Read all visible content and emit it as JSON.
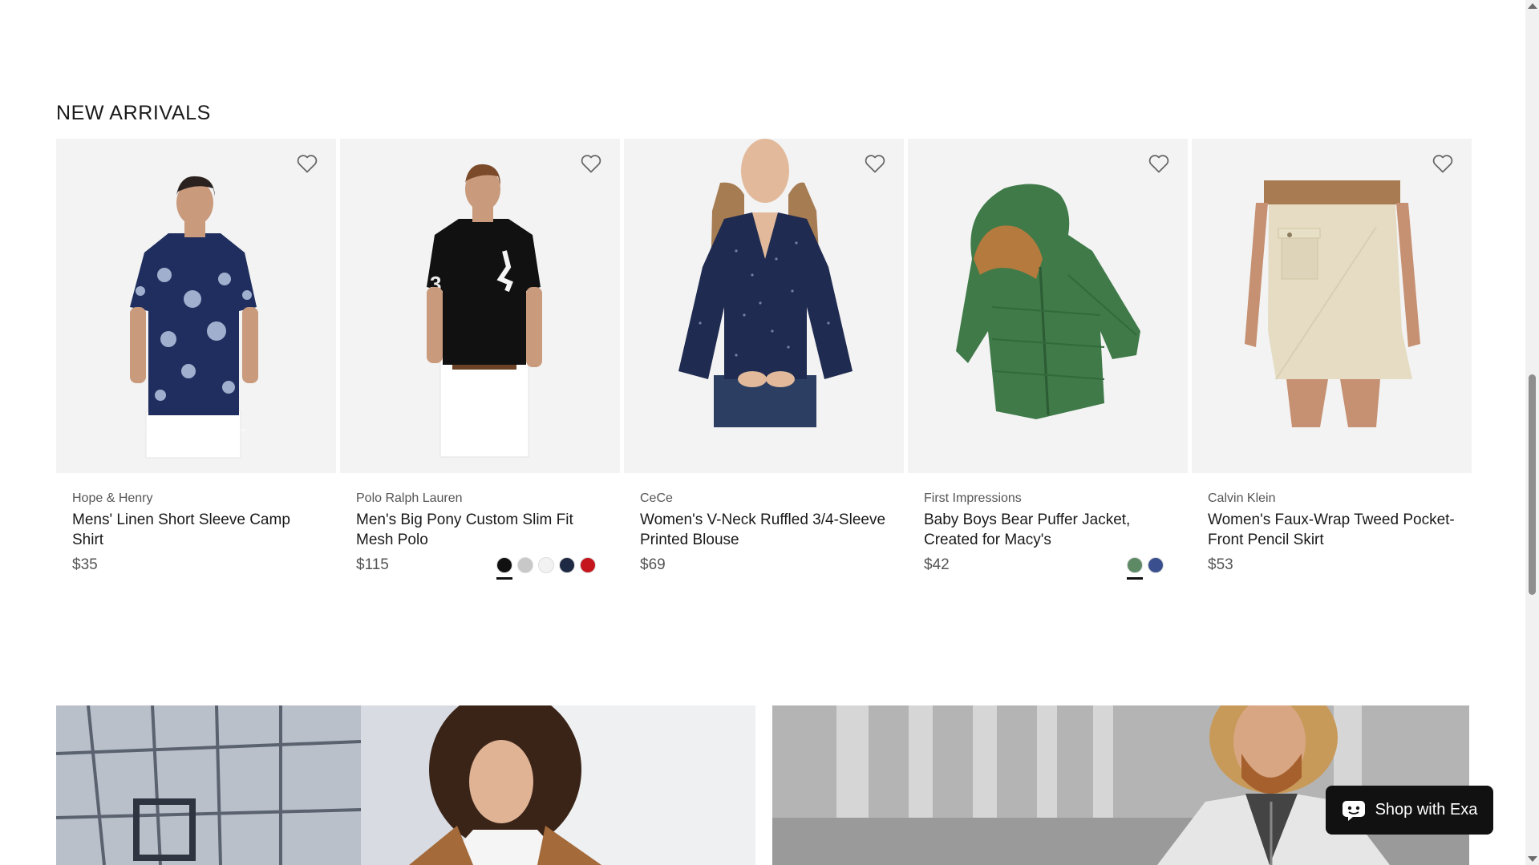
{
  "section": {
    "title": "NEW ARRIVALS"
  },
  "products": [
    {
      "brand": "Hope & Henry",
      "name": "Mens' Linen Short Sleeve Camp Shirt",
      "price": "$35",
      "image": "man-floral-shirt",
      "swatches": []
    },
    {
      "brand": "Polo Ralph Lauren",
      "name": "Men's Big Pony Custom Slim Fit Mesh Polo",
      "price": "$115",
      "image": "man-black-polo",
      "swatches": [
        "#111111",
        "#c8c8c8",
        "#f2f2f2",
        "#1e2a44",
        "#c4161c"
      ]
    },
    {
      "brand": "CeCe",
      "name": "Women's V-Neck Ruffled 3/4-Sleeve Printed Blouse",
      "price": "$69",
      "image": "woman-navy-blouse",
      "swatches": []
    },
    {
      "brand": "First Impressions",
      "name": "Baby Boys Bear Puffer Jacket, Created for Macy's",
      "price": "$42",
      "image": "green-puffer-jacket",
      "swatches": [
        "#5d8a64",
        "#3a4f8e"
      ]
    },
    {
      "brand": "Calvin Klein",
      "name": "Women's Faux-Wrap Tweed Pocket-Front Pencil Skirt",
      "price": "$53",
      "image": "beige-tweed-skirt",
      "swatches": []
    }
  ],
  "chat": {
    "label": "Shop with Exa",
    "icon": "chat-bot-icon"
  },
  "icons": {
    "favorite": "heart-outline-icon"
  }
}
